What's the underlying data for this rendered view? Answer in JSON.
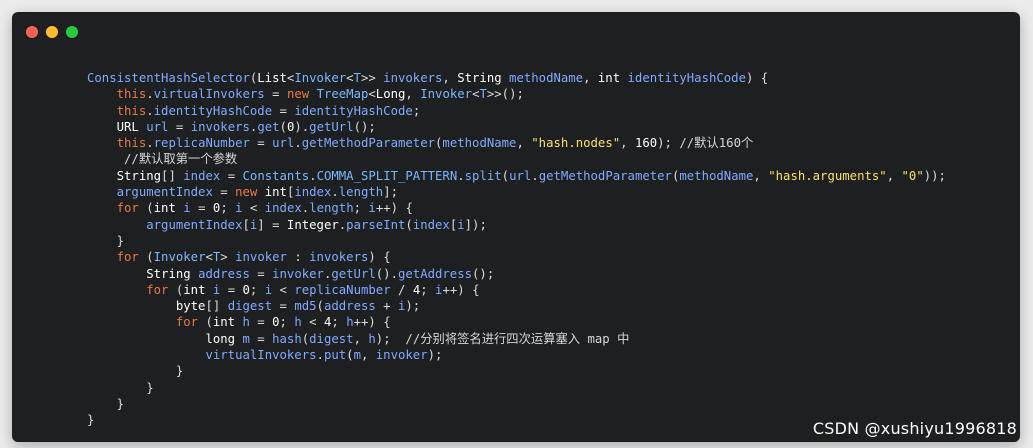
{
  "window": {
    "controls": [
      "close",
      "minimize",
      "maximize"
    ],
    "colors": {
      "close": "#fe5f57",
      "minimize": "#febb2e",
      "maximize": "#29c840",
      "background": "#1d1f21"
    }
  },
  "code_lines": [
    "ConsistentHashSelector(List<Invoker<T>> invokers, String methodName, int identityHashCode) {",
    "    this.virtualInvokers = new TreeMap<Long, Invoker<T>>();",
    "    this.identityHashCode = identityHashCode;",
    "    URL url = invokers.get(0).getUrl();",
    "    this.replicaNumber = url.getMethodParameter(methodName, \"hash.nodes\", 160); //默认160个",
    "     //默认取第一个参数",
    "    String[] index = Constants.COMMA_SPLIT_PATTERN.split(url.getMethodParameter(methodName, \"hash.arguments\", \"0\"));",
    "    argumentIndex = new int[index.length];",
    "    for (int i = 0; i < index.length; i++) {",
    "        argumentIndex[i] = Integer.parseInt(index[i]);",
    "    }",
    "    for (Invoker<T> invoker : invokers) {",
    "        String address = invoker.getUrl().getAddress();",
    "        for (int i = 0; i < replicaNumber / 4; i++) {",
    "            byte[] digest = md5(address + i);",
    "            for (int h = 0; h < 4; h++) {",
    "                long m = hash(digest, h);  //分别将签名进行四次运算塞入 map 中",
    "                virtualInvokers.put(m, invoker);",
    "            }",
    "        }",
    "    }",
    "}"
  ],
  "watermark": "CSDN @xushiyu1996818"
}
